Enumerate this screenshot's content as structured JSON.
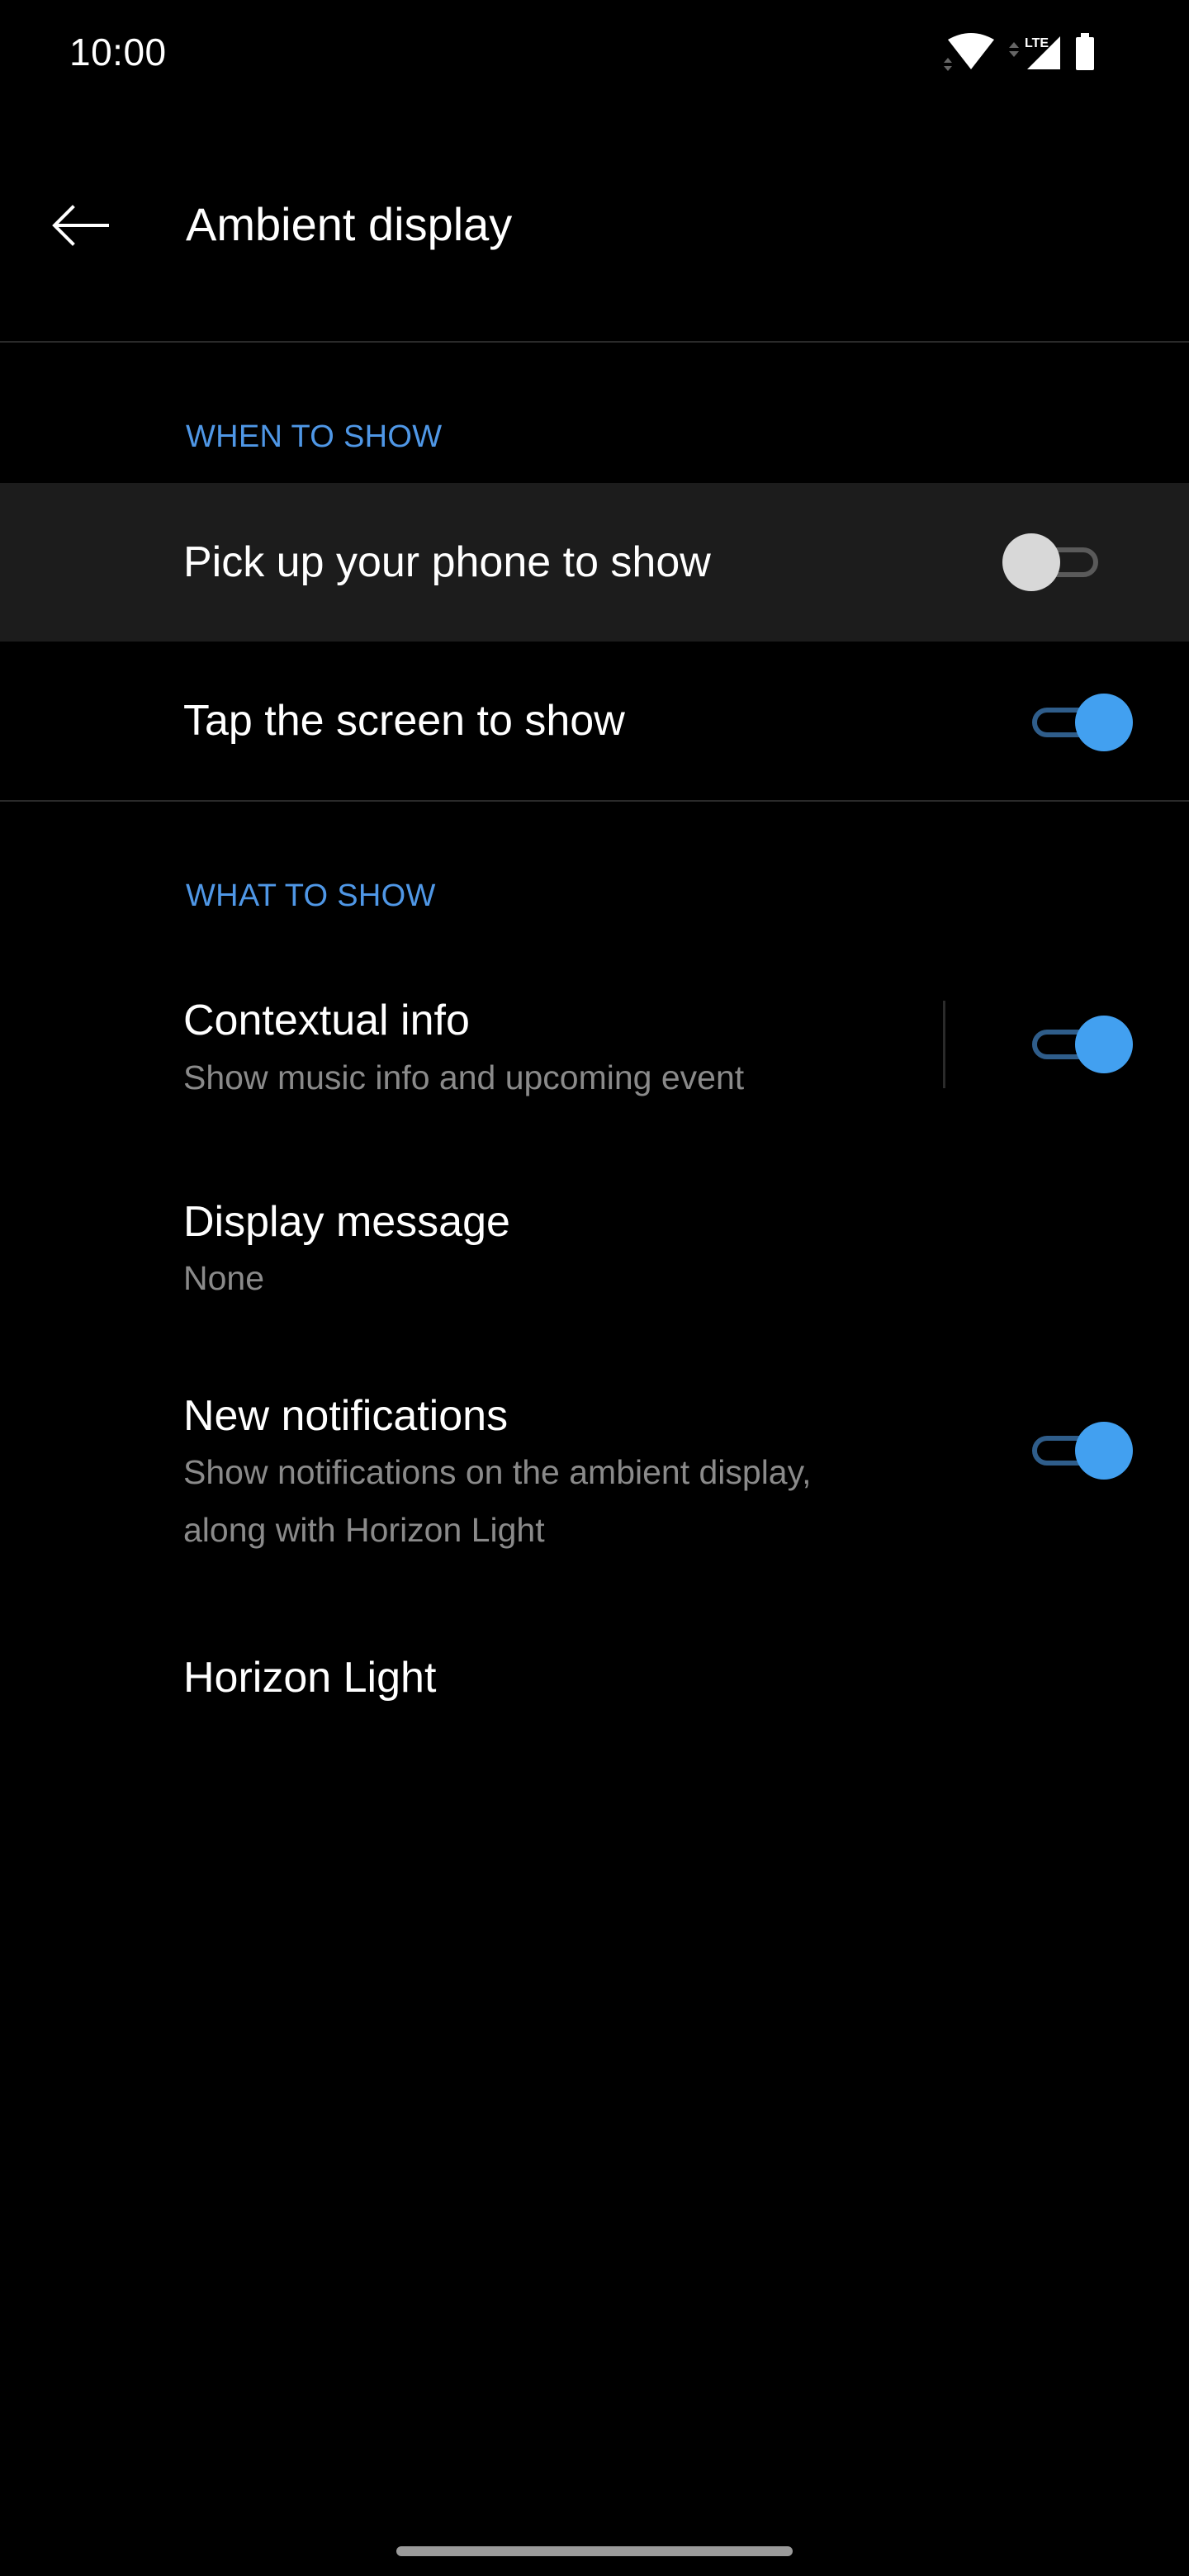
{
  "status_bar": {
    "time": "10:00",
    "network_label": "LTE",
    "icons": [
      "wifi-icon",
      "data-activity-icon",
      "cellular-signal-icon",
      "battery-icon"
    ]
  },
  "header": {
    "back_icon": "arrow-left-icon",
    "title": "Ambient display"
  },
  "sections": [
    {
      "header": "WHEN TO SHOW",
      "items": [
        {
          "title": "Pick up your phone to show",
          "toggle": false,
          "highlighted": true
        },
        {
          "title": "Tap the screen to show",
          "toggle": true
        }
      ]
    },
    {
      "header": "WHAT TO SHOW",
      "items": [
        {
          "title": "Contextual info",
          "subtitle": "Show music info and upcoming event",
          "toggle": true
        },
        {
          "title": "Display message",
          "subtitle": "None"
        },
        {
          "title": "New notifications",
          "subtitle_lines": [
            "Show notifications on the ambient display,",
            "along with Horizon Light"
          ],
          "toggle": true
        },
        {
          "title": "Horizon Light"
        }
      ]
    }
  ],
  "colors": {
    "accent": "#42a0f0",
    "section_header": "#4f97e6",
    "background": "#000000",
    "highlight_row": "#1c1c1c",
    "secondary_text": "#8a8a8a"
  }
}
